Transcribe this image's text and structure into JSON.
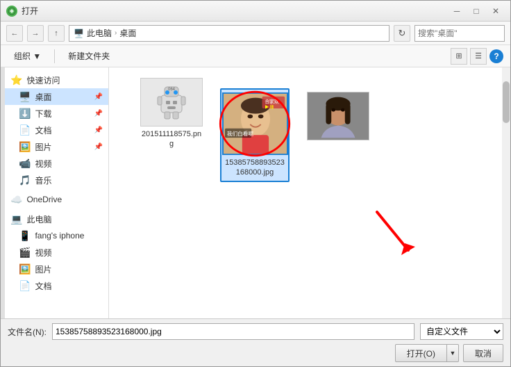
{
  "window": {
    "title": "打开",
    "close_btn": "✕",
    "minimize_btn": "─",
    "maximize_btn": "□"
  },
  "address_bar": {
    "back_btn": "←",
    "forward_btn": "→",
    "up_btn": "↑",
    "path_parts": [
      "此电脑",
      "桌面"
    ],
    "search_placeholder": "搜索\"桌面\"",
    "refresh_btn": "↻"
  },
  "toolbar": {
    "organize_label": "组织 ▼",
    "new_folder_label": "新建文件夹",
    "help_label": "?"
  },
  "sidebar": {
    "quick_access_label": "快速访问",
    "items": [
      {
        "id": "desktop",
        "label": "桌面",
        "icon": "🖥️",
        "pinned": true
      },
      {
        "id": "downloads",
        "label": "下载",
        "icon": "⬇️",
        "pinned": true
      },
      {
        "id": "documents",
        "label": "文档",
        "icon": "📄",
        "pinned": true
      },
      {
        "id": "pictures",
        "label": "图片",
        "icon": "🖼️",
        "pinned": true
      },
      {
        "id": "videos",
        "label": "视频",
        "icon": "📹",
        "pinned": false
      },
      {
        "id": "music",
        "label": "音乐",
        "icon": "🎵",
        "pinned": false
      }
    ],
    "onedrive_label": "OneDrive",
    "thispc_label": "此电脑",
    "thispc_items": [
      {
        "id": "iphone",
        "label": "fang's iphone",
        "icon": "📱"
      },
      {
        "id": "videos2",
        "label": "视频",
        "icon": "🎬"
      },
      {
        "id": "pictures2",
        "label": "图片",
        "icon": "🖼️"
      },
      {
        "id": "documents2",
        "label": "文档",
        "icon": "📄"
      }
    ]
  },
  "files": [
    {
      "id": "robot",
      "name": "201511118575.png",
      "type": "robot",
      "selected": false
    },
    {
      "id": "child",
      "name": "1538575889352316800​0.jpg",
      "type": "child",
      "selected": true
    },
    {
      "id": "girl",
      "name": "",
      "type": "girl",
      "selected": false
    }
  ],
  "bottom": {
    "filename_label": "文件名(N):",
    "filename_value": "1538575889352316800​0.jpg",
    "filetype_label": "自定义文件",
    "open_btn_label": "打开(O)",
    "cancel_btn_label": "取消",
    "dropdown_arrow": "▼"
  }
}
